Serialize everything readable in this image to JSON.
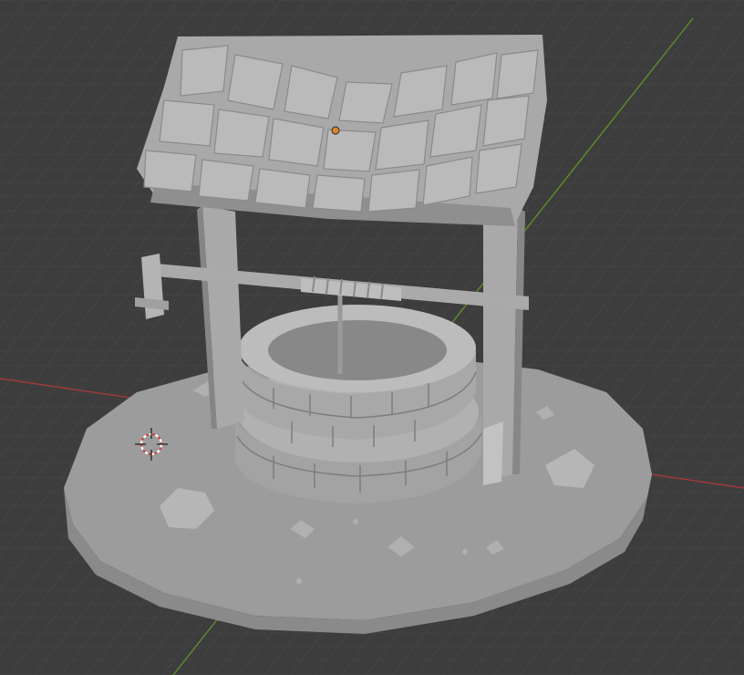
{
  "viewport": {
    "background": "#3d3d3d",
    "grid_color": "#494949",
    "x_axis_color": "#b13b3b",
    "y_axis_color": "#6a9a2a",
    "model_color": "#a6a6a6",
    "model_shadow": "#7d7d7d",
    "model_highlight": "#c3c3c3",
    "object_origin_color": "#e0852a",
    "3d_cursor_color": "#e05050"
  },
  "icons": {
    "cursor": "3d-cursor-icon",
    "origin": "object-origin-icon"
  }
}
